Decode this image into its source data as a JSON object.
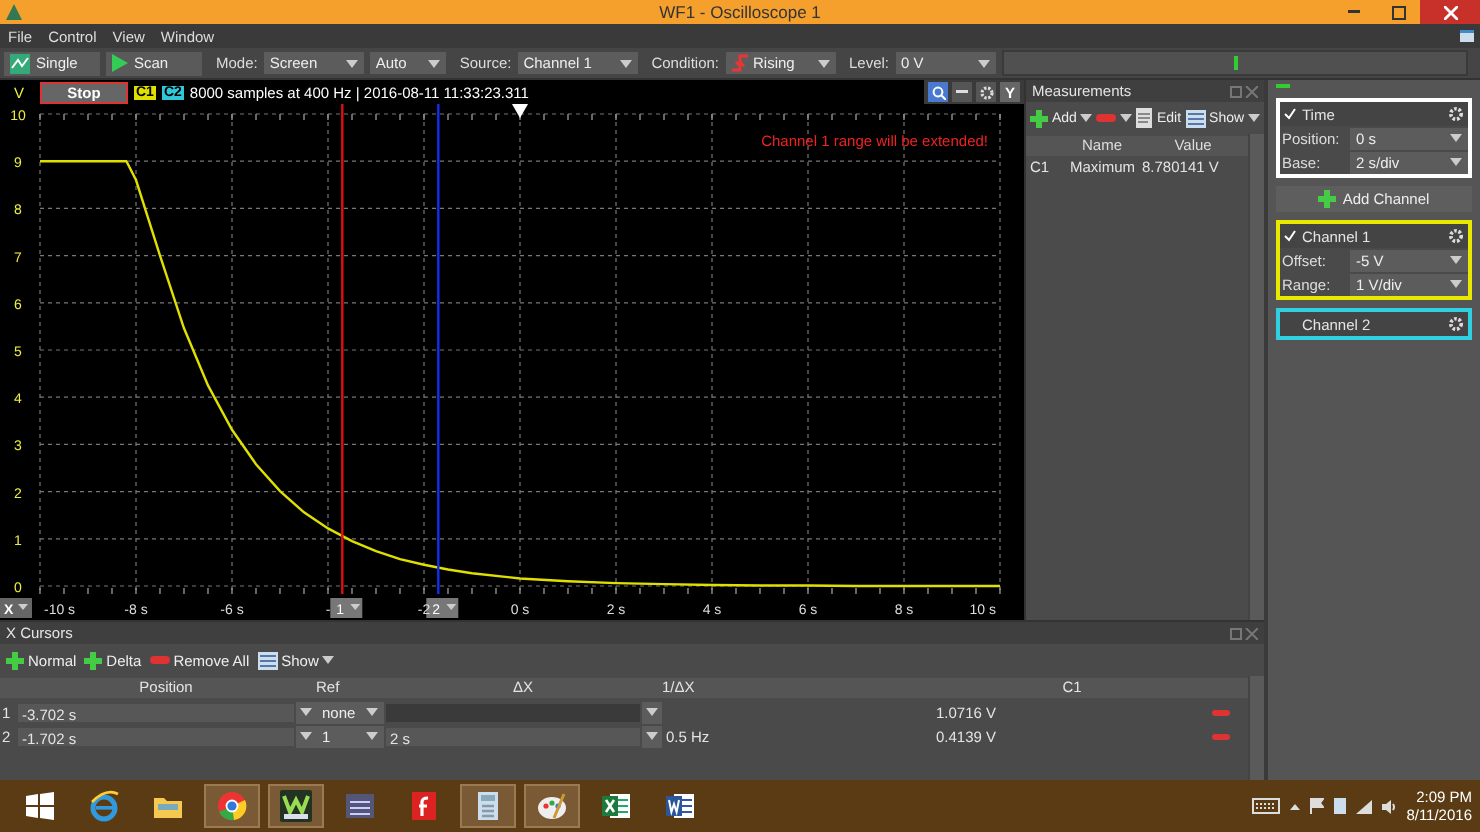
{
  "window": {
    "title": "WF1 - Oscilloscope 1"
  },
  "menu": [
    "File",
    "Control",
    "View",
    "Window"
  ],
  "toolbar": {
    "buttons": [
      {
        "label": "Single",
        "kind": "single"
      },
      {
        "label": "Scan",
        "kind": "scan"
      }
    ],
    "fields": [
      {
        "label": "Mode:",
        "value": "Screen"
      },
      {
        "value": "Auto"
      },
      {
        "label": "Source:",
        "value": "Channel 1"
      },
      {
        "label": "Condition:",
        "value": "Rising",
        "kind": "edge"
      },
      {
        "label": "Level:",
        "value": "0 V"
      }
    ],
    "level_slider": {
      "level": 0.5
    }
  },
  "plot": {
    "run_button": "Stop",
    "channels": [
      {
        "label": "C1",
        "color": "#e0e000"
      },
      {
        "label": "C2",
        "color": "#30c8d8"
      }
    ],
    "info": "8000 samples at 400 Hz | 2016-08-11 11:33:23.311",
    "warning": "Channel 1 range will be extended!",
    "y_unit": "V",
    "axis_button": "Y",
    "x_button": "X",
    "chart_data": {
      "type": "line",
      "x": [
        -10,
        -9,
        -8.2,
        -8,
        -7.5,
        -7,
        -6.5,
        -6,
        -5.5,
        -5,
        -4.5,
        -4,
        -3.5,
        -3,
        -2.5,
        -2,
        -1.5,
        -1,
        0,
        1,
        2,
        3,
        4,
        5,
        6,
        7,
        8,
        9,
        10
      ],
      "series": [
        {
          "color": "#e0e000",
          "values": [
            9,
            9,
            9,
            8.6,
            7.0,
            5.46,
            4.25,
            3.31,
            2.58,
            2.01,
            1.56,
            1.22,
            0.95,
            0.74,
            0.57,
            0.45,
            0.35,
            0.27,
            0.16,
            0.1,
            0.06,
            0.04,
            0.02,
            0.01,
            0.01,
            0,
            0,
            0,
            0
          ]
        }
      ],
      "xlim": [
        -10,
        10
      ],
      "ylim": [
        0,
        10
      ],
      "xticks": [
        {
          "value": -10,
          "label": "-10 s"
        },
        {
          "value": -8,
          "label": "-8 s"
        },
        {
          "value": -6,
          "label": "-6 s"
        },
        {
          "value": -4,
          "label": "-"
        },
        {
          "value": -2,
          "label": "-2"
        },
        {
          "value": 0,
          "label": "0 s"
        },
        {
          "value": 2,
          "label": "2 s"
        },
        {
          "value": 4,
          "label": "4 s"
        },
        {
          "value": 6,
          "label": "6 s"
        },
        {
          "value": 8,
          "label": "8 s"
        },
        {
          "value": 10,
          "label": "10 s"
        }
      ],
      "yticks": [
        0,
        1,
        2,
        3,
        4,
        5,
        6,
        7,
        8,
        9,
        10
      ],
      "grid": true,
      "ref_lines": [
        {
          "axis": "x",
          "value": -3.702,
          "color": "#e01010"
        },
        {
          "axis": "x",
          "value": -1.702,
          "color": "#1030f0"
        }
      ]
    },
    "cursor_tags": [
      "1",
      "2"
    ]
  },
  "measurements": {
    "title": "Measurements",
    "toolbar": [
      {
        "label": "Add",
        "kind": "add"
      },
      {
        "kind": "remove"
      },
      {
        "label": "Edit",
        "kind": "edit"
      },
      {
        "label": "Show",
        "kind": "show"
      }
    ],
    "columns": [
      "Name",
      "Value"
    ],
    "rows": [
      {
        "channel": "C1",
        "name": "Maximum",
        "value": "8.780141 V"
      }
    ]
  },
  "settings": {
    "cards": [
      {
        "kind": "card",
        "title": "Time",
        "checked": true,
        "color": "#ffffff",
        "fields": [
          {
            "label": "Position:",
            "value": "0 s"
          },
          {
            "label": "Base:",
            "value": "2 s/div"
          }
        ]
      },
      {
        "kind": "add",
        "label": "Add Channel"
      },
      {
        "kind": "card",
        "title": "Channel 1",
        "checked": true,
        "color": "#e8e800",
        "fields": [
          {
            "label": "Offset:",
            "value": "-5 V"
          },
          {
            "label": "Range:",
            "value": "1 V/div"
          }
        ]
      },
      {
        "kind": "card",
        "title": "Channel 2",
        "checked": false,
        "color": "#30d0e0"
      }
    ]
  },
  "x_cursors": {
    "title": "X Cursors",
    "toolbar": [
      {
        "label": "Normal",
        "kind": "add"
      },
      {
        "label": "Delta",
        "kind": "add"
      },
      {
        "label": "Remove All",
        "kind": "remove"
      },
      {
        "label": "Show",
        "kind": "show"
      }
    ],
    "columns": [
      "Position",
      "Ref",
      "ΔX",
      "1/ΔX",
      "C1"
    ],
    "rows": [
      {
        "index": "1",
        "position": "-3.702 s",
        "ref": "none",
        "c1": "1.0716 V"
      },
      {
        "index": "2",
        "position": "-1.702 s",
        "ref": "1",
        "delta": "2 s",
        "inverse": "0.5 Hz",
        "c1": "0.4139 V"
      }
    ]
  },
  "taskbar": {
    "apps": [
      {
        "kind": "start",
        "running": false
      },
      {
        "kind": "ie",
        "running": false
      },
      {
        "kind": "folder",
        "running": false
      },
      {
        "kind": "chrome",
        "running": true
      },
      {
        "kind": "waveforms",
        "running": true
      },
      {
        "kind": "chart",
        "running": false
      },
      {
        "kind": "reader",
        "running": false
      },
      {
        "kind": "calc",
        "running": true
      },
      {
        "kind": "paint",
        "running": true
      },
      {
        "kind": "sheet",
        "running": false
      },
      {
        "kind": "doc",
        "running": false
      }
    ],
    "clock": {
      "time": "2:09 PM",
      "date": "8/11/2016"
    }
  }
}
